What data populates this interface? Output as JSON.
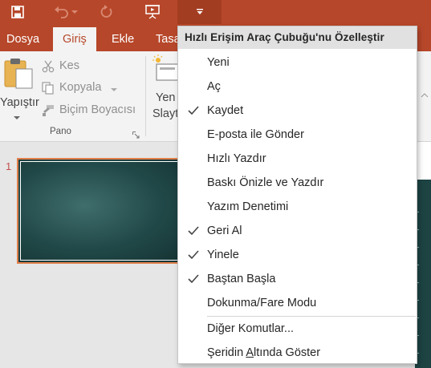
{
  "colors": {
    "accent": "#b7472a",
    "ribbon_bg": "#f3f3f3",
    "menu_header_bg": "#e1e1e1",
    "slide_border": "#e07f4a"
  },
  "quick_access": {
    "icons": [
      "save-icon",
      "undo-icon",
      "undo-dropdown-icon",
      "redo-icon",
      "presentation-icon",
      "customize-dropdown-icon"
    ]
  },
  "tabs": [
    {
      "label": "Dosya"
    },
    {
      "label": "Giriş"
    },
    {
      "label": "Ekle"
    },
    {
      "label": "Tasa"
    }
  ],
  "ribbon": {
    "paste_label": "Yapıştır",
    "cut_label": "Kes",
    "copy_label": "Kopyala",
    "format_painter_label": "Biçim Boyacısı",
    "clipboard_group_label": "Pano",
    "new_slide_line1": "Yen",
    "new_slide_line2": "Slayt"
  },
  "slides": {
    "current_number": "1"
  },
  "menu": {
    "header": "Hızlı Erişim Araç Çubuğu'nu Özelleştir",
    "items": [
      {
        "label": "Yeni",
        "checked": false
      },
      {
        "label": "Aç",
        "checked": false
      },
      {
        "label": "Kaydet",
        "checked": true
      },
      {
        "label": "E-posta ile Gönder",
        "checked": false
      },
      {
        "label": "Hızlı Yazdır",
        "checked": false
      },
      {
        "label": "Baskı Önizle ve Yazdır",
        "checked": false
      },
      {
        "label": "Yazım Denetimi",
        "checked": false
      },
      {
        "label": "Geri Al",
        "checked": true
      },
      {
        "label": "Yinele",
        "checked": true
      },
      {
        "label": "Baştan Başla",
        "checked": true
      },
      {
        "label": "Dokunma/Fare Modu",
        "checked": false
      }
    ],
    "more_commands": {
      "before": "Di",
      "accel": "ğ",
      "after": "er Komutlar..."
    },
    "show_below": {
      "before": "Şeridin ",
      "accel": "A",
      "after": "ltında Göster"
    }
  }
}
